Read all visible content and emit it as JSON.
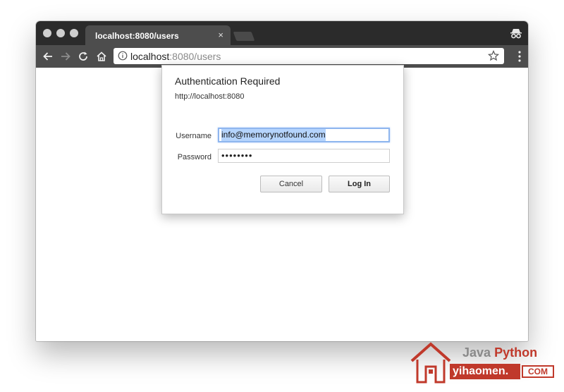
{
  "browser": {
    "tab_title": "localhost:8080/users",
    "tab_close": "×",
    "url_host": "localhost",
    "url_rest": ":8080/users",
    "icons": [
      "back-icon",
      "forward-icon",
      "reload-icon",
      "home-icon",
      "info-icon",
      "star-icon",
      "menu-icon",
      "incognito-icon"
    ]
  },
  "dialog": {
    "title": "Authentication Required",
    "origin": "http://localhost:8080",
    "username_label": "Username",
    "username_value": "info@memorynotfound.com",
    "password_label": "Password",
    "password_value": "••••••••",
    "cancel_label": "Cancel",
    "login_label": "Log In"
  },
  "watermark": {
    "java": "Java",
    "python": "Python",
    "site": "yihaomen.",
    "com": "COM"
  },
  "colors": {
    "titlebar": "#2b2b2b",
    "toolbar": "#4d4d4d",
    "focus_ring": "#8fb6ee",
    "selection": "#b5d4fd",
    "watermark_red": "#c0392b"
  }
}
